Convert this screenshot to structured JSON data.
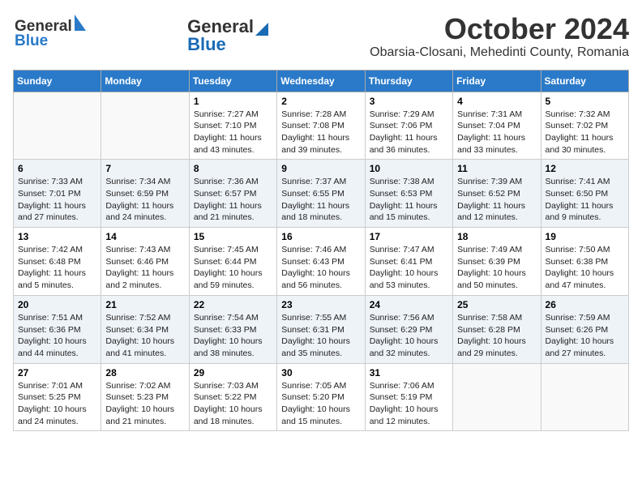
{
  "header": {
    "logo_general": "General",
    "logo_blue": "Blue",
    "month": "October 2024",
    "location": "Obarsia-Closani, Mehedinti County, Romania"
  },
  "days_of_week": [
    "Sunday",
    "Monday",
    "Tuesday",
    "Wednesday",
    "Thursday",
    "Friday",
    "Saturday"
  ],
  "weeks": [
    [
      {
        "day": "",
        "empty": true
      },
      {
        "day": "",
        "empty": true
      },
      {
        "day": "1",
        "sunrise": "Sunrise: 7:27 AM",
        "sunset": "Sunset: 7:10 PM",
        "daylight": "Daylight: 11 hours and 43 minutes."
      },
      {
        "day": "2",
        "sunrise": "Sunrise: 7:28 AM",
        "sunset": "Sunset: 7:08 PM",
        "daylight": "Daylight: 11 hours and 39 minutes."
      },
      {
        "day": "3",
        "sunrise": "Sunrise: 7:29 AM",
        "sunset": "Sunset: 7:06 PM",
        "daylight": "Daylight: 11 hours and 36 minutes."
      },
      {
        "day": "4",
        "sunrise": "Sunrise: 7:31 AM",
        "sunset": "Sunset: 7:04 PM",
        "daylight": "Daylight: 11 hours and 33 minutes."
      },
      {
        "day": "5",
        "sunrise": "Sunrise: 7:32 AM",
        "sunset": "Sunset: 7:02 PM",
        "daylight": "Daylight: 11 hours and 30 minutes."
      }
    ],
    [
      {
        "day": "6",
        "sunrise": "Sunrise: 7:33 AM",
        "sunset": "Sunset: 7:01 PM",
        "daylight": "Daylight: 11 hours and 27 minutes."
      },
      {
        "day": "7",
        "sunrise": "Sunrise: 7:34 AM",
        "sunset": "Sunset: 6:59 PM",
        "daylight": "Daylight: 11 hours and 24 minutes."
      },
      {
        "day": "8",
        "sunrise": "Sunrise: 7:36 AM",
        "sunset": "Sunset: 6:57 PM",
        "daylight": "Daylight: 11 hours and 21 minutes."
      },
      {
        "day": "9",
        "sunrise": "Sunrise: 7:37 AM",
        "sunset": "Sunset: 6:55 PM",
        "daylight": "Daylight: 11 hours and 18 minutes."
      },
      {
        "day": "10",
        "sunrise": "Sunrise: 7:38 AM",
        "sunset": "Sunset: 6:53 PM",
        "daylight": "Daylight: 11 hours and 15 minutes."
      },
      {
        "day": "11",
        "sunrise": "Sunrise: 7:39 AM",
        "sunset": "Sunset: 6:52 PM",
        "daylight": "Daylight: 11 hours and 12 minutes."
      },
      {
        "day": "12",
        "sunrise": "Sunrise: 7:41 AM",
        "sunset": "Sunset: 6:50 PM",
        "daylight": "Daylight: 11 hours and 9 minutes."
      }
    ],
    [
      {
        "day": "13",
        "sunrise": "Sunrise: 7:42 AM",
        "sunset": "Sunset: 6:48 PM",
        "daylight": "Daylight: 11 hours and 5 minutes."
      },
      {
        "day": "14",
        "sunrise": "Sunrise: 7:43 AM",
        "sunset": "Sunset: 6:46 PM",
        "daylight": "Daylight: 11 hours and 2 minutes."
      },
      {
        "day": "15",
        "sunrise": "Sunrise: 7:45 AM",
        "sunset": "Sunset: 6:44 PM",
        "daylight": "Daylight: 10 hours and 59 minutes."
      },
      {
        "day": "16",
        "sunrise": "Sunrise: 7:46 AM",
        "sunset": "Sunset: 6:43 PM",
        "daylight": "Daylight: 10 hours and 56 minutes."
      },
      {
        "day": "17",
        "sunrise": "Sunrise: 7:47 AM",
        "sunset": "Sunset: 6:41 PM",
        "daylight": "Daylight: 10 hours and 53 minutes."
      },
      {
        "day": "18",
        "sunrise": "Sunrise: 7:49 AM",
        "sunset": "Sunset: 6:39 PM",
        "daylight": "Daylight: 10 hours and 50 minutes."
      },
      {
        "day": "19",
        "sunrise": "Sunrise: 7:50 AM",
        "sunset": "Sunset: 6:38 PM",
        "daylight": "Daylight: 10 hours and 47 minutes."
      }
    ],
    [
      {
        "day": "20",
        "sunrise": "Sunrise: 7:51 AM",
        "sunset": "Sunset: 6:36 PM",
        "daylight": "Daylight: 10 hours and 44 minutes."
      },
      {
        "day": "21",
        "sunrise": "Sunrise: 7:52 AM",
        "sunset": "Sunset: 6:34 PM",
        "daylight": "Daylight: 10 hours and 41 minutes."
      },
      {
        "day": "22",
        "sunrise": "Sunrise: 7:54 AM",
        "sunset": "Sunset: 6:33 PM",
        "daylight": "Daylight: 10 hours and 38 minutes."
      },
      {
        "day": "23",
        "sunrise": "Sunrise: 7:55 AM",
        "sunset": "Sunset: 6:31 PM",
        "daylight": "Daylight: 10 hours and 35 minutes."
      },
      {
        "day": "24",
        "sunrise": "Sunrise: 7:56 AM",
        "sunset": "Sunset: 6:29 PM",
        "daylight": "Daylight: 10 hours and 32 minutes."
      },
      {
        "day": "25",
        "sunrise": "Sunrise: 7:58 AM",
        "sunset": "Sunset: 6:28 PM",
        "daylight": "Daylight: 10 hours and 29 minutes."
      },
      {
        "day": "26",
        "sunrise": "Sunrise: 7:59 AM",
        "sunset": "Sunset: 6:26 PM",
        "daylight": "Daylight: 10 hours and 27 minutes."
      }
    ],
    [
      {
        "day": "27",
        "sunrise": "Sunrise: 7:01 AM",
        "sunset": "Sunset: 5:25 PM",
        "daylight": "Daylight: 10 hours and 24 minutes."
      },
      {
        "day": "28",
        "sunrise": "Sunrise: 7:02 AM",
        "sunset": "Sunset: 5:23 PM",
        "daylight": "Daylight: 10 hours and 21 minutes."
      },
      {
        "day": "29",
        "sunrise": "Sunrise: 7:03 AM",
        "sunset": "Sunset: 5:22 PM",
        "daylight": "Daylight: 10 hours and 18 minutes."
      },
      {
        "day": "30",
        "sunrise": "Sunrise: 7:05 AM",
        "sunset": "Sunset: 5:20 PM",
        "daylight": "Daylight: 10 hours and 15 minutes."
      },
      {
        "day": "31",
        "sunrise": "Sunrise: 7:06 AM",
        "sunset": "Sunset: 5:19 PM",
        "daylight": "Daylight: 10 hours and 12 minutes."
      },
      {
        "day": "",
        "empty": true
      },
      {
        "day": "",
        "empty": true
      }
    ]
  ]
}
